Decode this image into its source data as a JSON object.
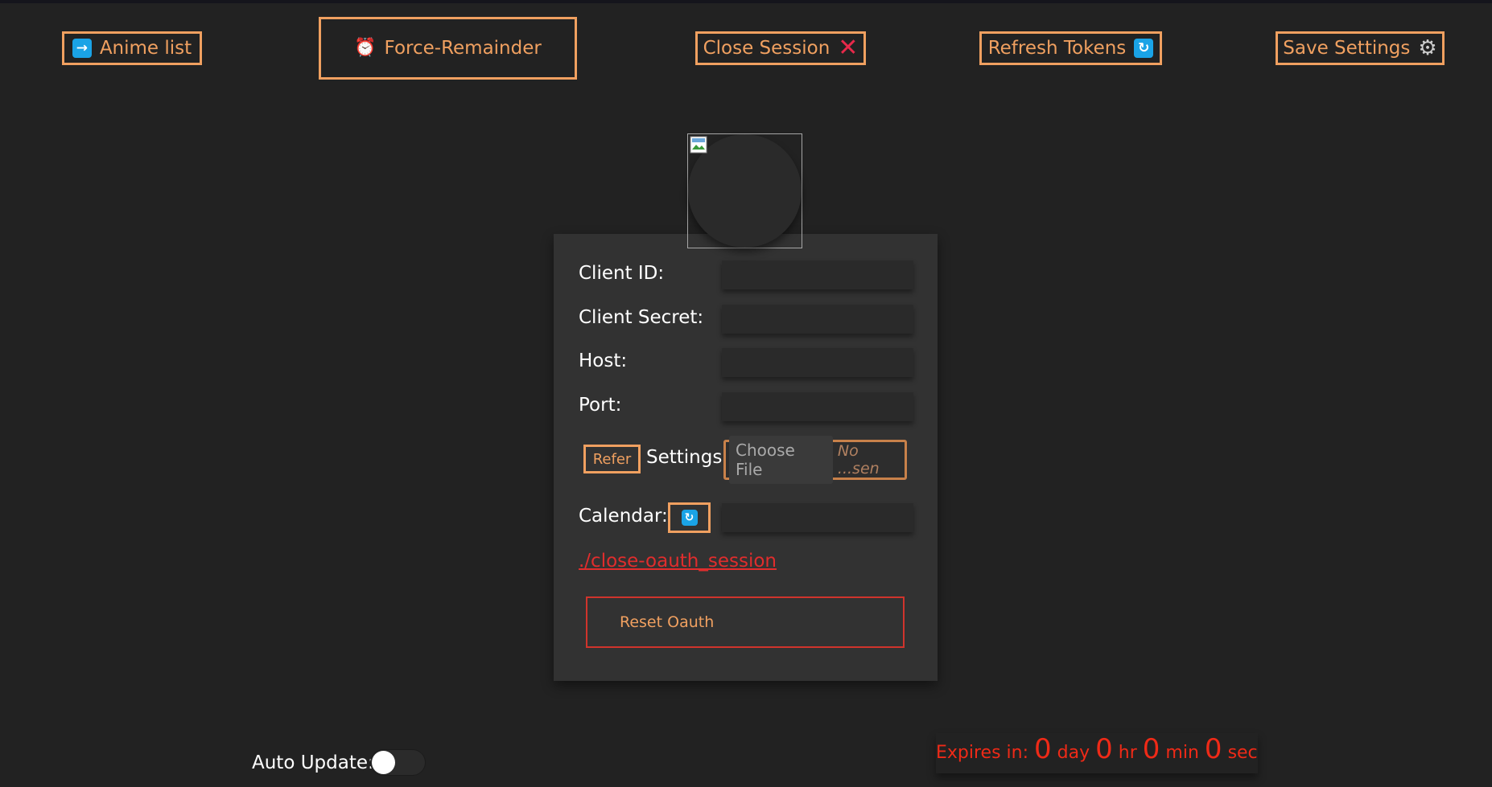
{
  "top_buttons": {
    "anime_list": {
      "label": "Anime list",
      "icon": "arrow-right-icon"
    },
    "force_reminder": {
      "label": "Force-Remainder",
      "icon": "alarm-clock-icon"
    },
    "close_session": {
      "label": "Close Session",
      "icon": "cross-icon"
    },
    "refresh_tokens": {
      "label": "Refresh Tokens",
      "icon": "refresh-icon"
    },
    "save_settings": {
      "label": "Save Settings",
      "icon": "gear-icon"
    }
  },
  "panel": {
    "client_id_label": "Client ID:",
    "client_secret_label": "Client Secret:",
    "host_label": "Host:",
    "port_label": "Port:",
    "refer_label": "Refer",
    "settings_label": "Settings:",
    "choose_file_label": "Choose File",
    "no_file_text": "No ...sen",
    "calendar_label": "Calendar:",
    "oauth_link": "./close-oauth_session",
    "reset_oauth_label": "Reset Oauth"
  },
  "footer": {
    "auto_update_label": "Auto Update:",
    "auto_update_on": false,
    "expires_label": "Expires in:",
    "days": "0",
    "days_unit": "day",
    "hours": "0",
    "hours_unit": "hr",
    "minutes": "0",
    "minutes_unit": "min",
    "seconds": "0",
    "seconds_unit": "sec"
  },
  "colors": {
    "background": "#222222",
    "accent": "#f0a060",
    "danger": "#e02d2d",
    "icon_blue": "#1aa3e6"
  }
}
